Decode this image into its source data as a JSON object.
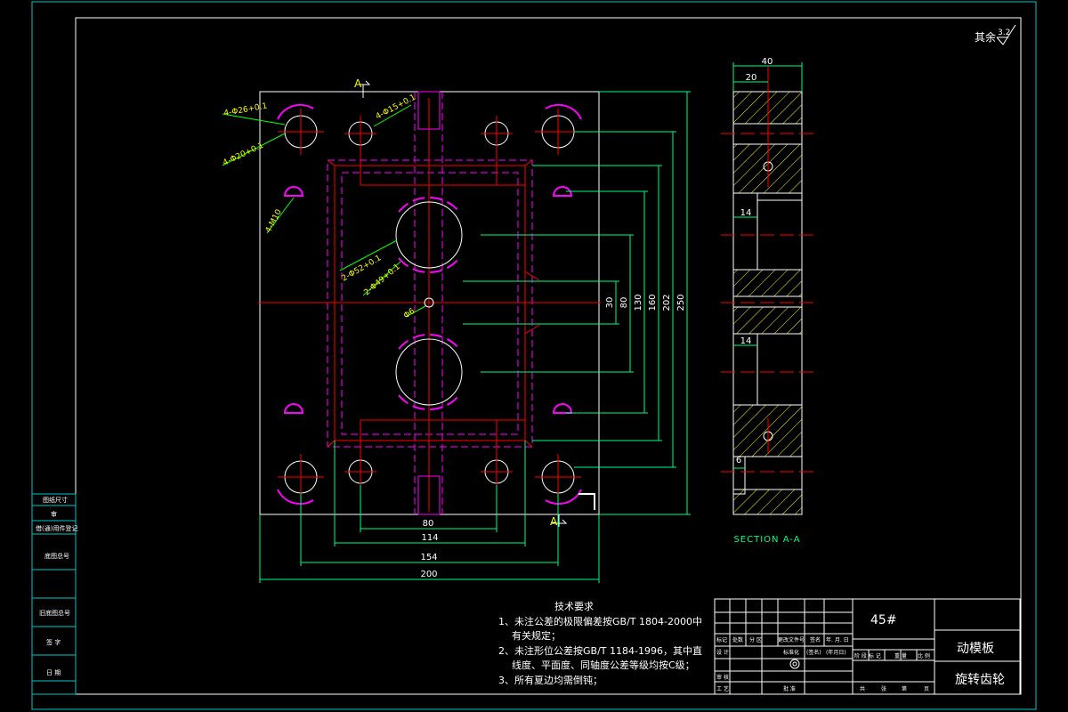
{
  "roughness": {
    "label": "其余",
    "value": "3.2"
  },
  "plan": {
    "callouts": {
      "holes_26": "4-Φ26+0.1",
      "holes_20": "4-Φ20+0.1",
      "holes_15": "4-Φ15+0.1",
      "thread_m10": "4-M10",
      "holes_52": "2-Φ52+0.1",
      "holes_49": "2-Φ49+0.1",
      "hole_6": "Φ6"
    },
    "section_mark": "A",
    "dims_horizontal": [
      "80",
      "114",
      "154",
      "200"
    ],
    "dims_vertical": [
      "30",
      "80",
      "130",
      "160",
      "202",
      "250"
    ]
  },
  "section": {
    "title": "SECTION A-A",
    "dims": [
      "40",
      "20",
      "14",
      "14",
      "6"
    ]
  },
  "tech_notes": {
    "title": "技术要求",
    "lines": [
      "1、未注公差的极限偏差按GB/T 1804-2000中",
      "有关规定；",
      "2、未注形位公差按GB/T 1184-1996，其中直",
      "线度、平面度、同轴度公差等级均按C级；",
      "3、所有夏边均需倒钝；"
    ]
  },
  "side_table": [
    "图纸尺寸",
    "审",
    "借(通)用件登记",
    "旧底图总号",
    "底图总号",
    "签 字",
    "日 期"
  ],
  "title_block": {
    "material": "45#",
    "part_name": "动模板",
    "project": "旋转齿轮",
    "revision_headers": [
      "标记",
      "处数",
      "分 区",
      "更改文件号",
      "签名",
      "年. 月. 日"
    ],
    "rows": [
      "设 计",
      "标准化",
      "(签名)",
      "(年月日)",
      "审 核",
      "工 艺",
      "批 准"
    ],
    "stage_headers": [
      "阶 段 标 记",
      "重 量",
      "比 例"
    ],
    "sheet_footer": [
      "共",
      "张",
      "第",
      "页"
    ]
  },
  "colors": {
    "frame": "#00c8c8",
    "outline": "#ffffff",
    "center": "#ff0000",
    "hidden": "#ff00ff",
    "dim": "#00ff80",
    "hatch": "#ffff00",
    "leader": "#00ff00"
  }
}
